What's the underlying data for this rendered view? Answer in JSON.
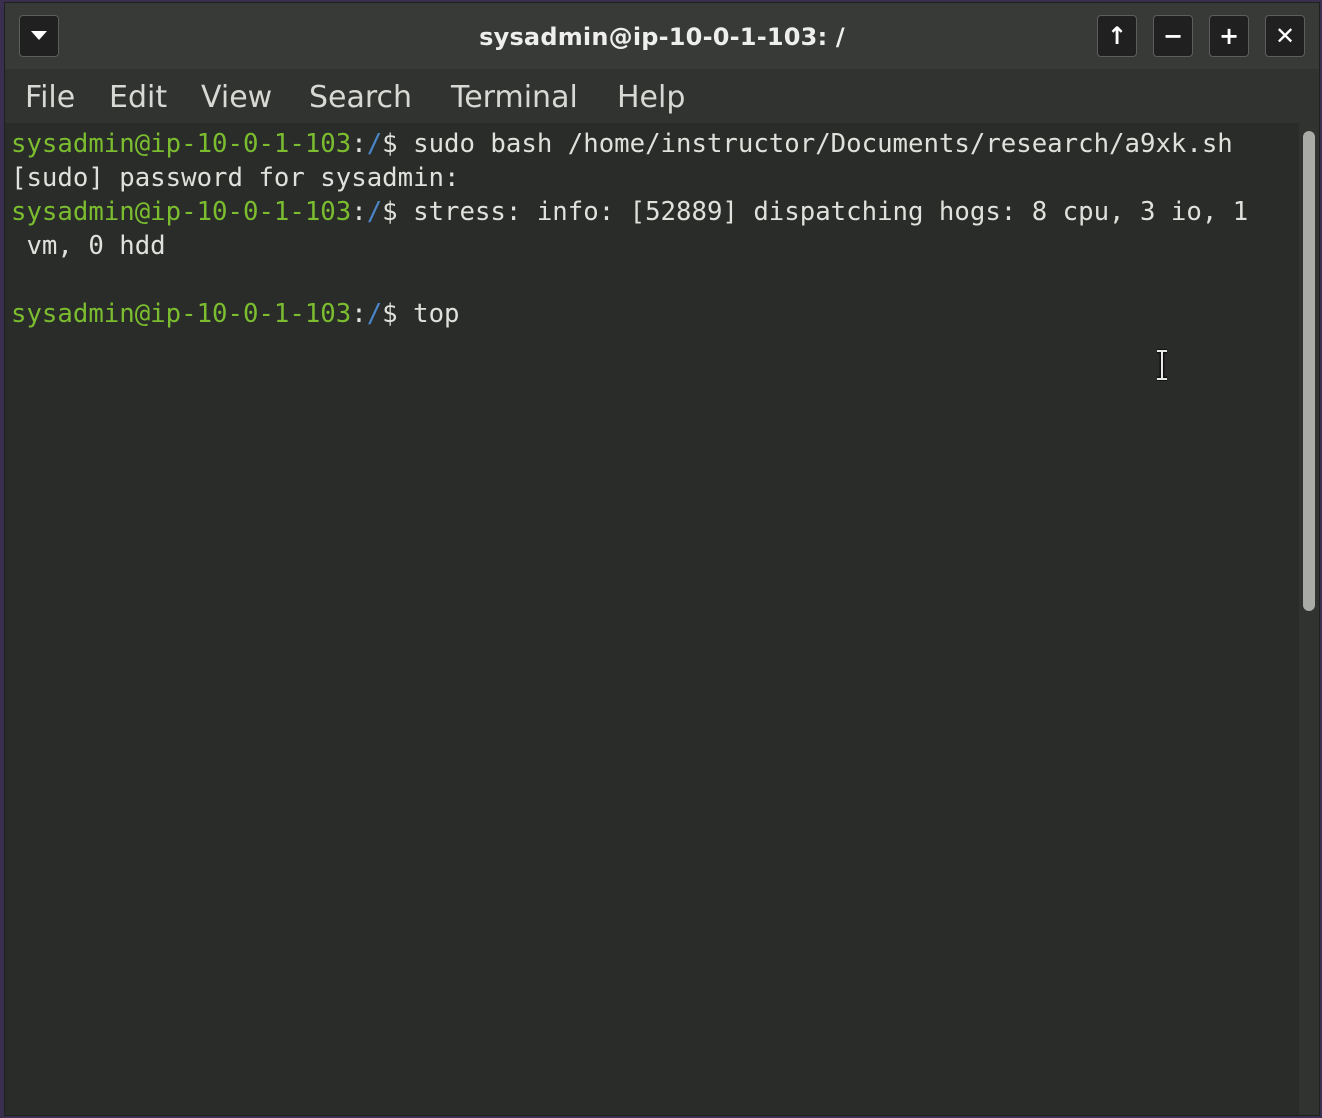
{
  "window": {
    "title": "sysadmin@ip-10-0-1-103: /",
    "buttons": {
      "menu": "menu-dropdown-icon",
      "up": "↑",
      "minimize": "−",
      "maximize": "+",
      "close": "✕"
    }
  },
  "menubar": {
    "items": [
      "File",
      "Edit",
      "View",
      "Search",
      "Terminal",
      "Help"
    ]
  },
  "terminal": {
    "prompt_user": "sysadmin@ip-10-0-1-103",
    "prompt_sep": ":",
    "prompt_path": "/",
    "prompt_end": "$ ",
    "lines": [
      {
        "type": "prompt",
        "text": "sudo bash /home/instructor/Documents/research/a9xk.sh"
      },
      {
        "type": "output",
        "text": "[sudo] password for sysadmin:"
      },
      {
        "type": "prompt",
        "text": "stress: info: [52889] dispatching hogs: 8 cpu, 3 io, 1"
      },
      {
        "type": "output",
        "text": " vm, 0 hdd"
      },
      {
        "type": "output",
        "text": ""
      },
      {
        "type": "prompt",
        "text": "top"
      }
    ]
  },
  "colors": {
    "prompt_user": "#7bbd2f",
    "prompt_path": "#4a86c8",
    "background": "#292c29",
    "text": "#e0e0dc"
  }
}
